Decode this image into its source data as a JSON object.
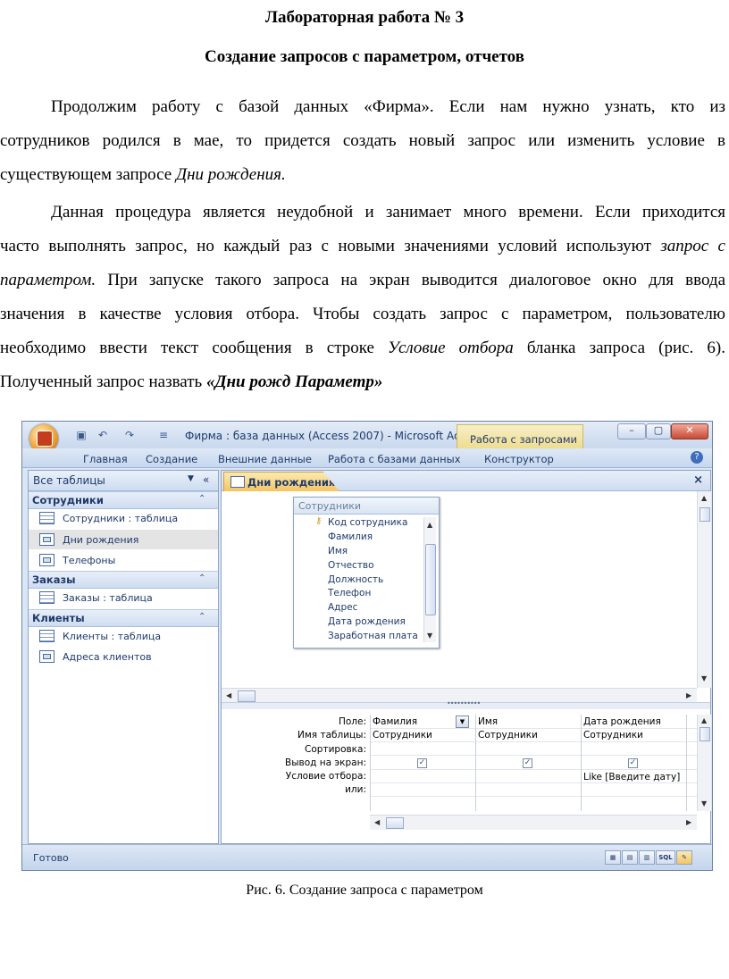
{
  "document": {
    "heading1": "Лабораторная работа № 3",
    "heading2": "Создание запросов с параметром,  отчетов",
    "p1": {
      "t1": "Продолжим работу с базой данных «Фирма». Если нам нужно узнать, кто из",
      "t2": "сотрудников родился в мае, то придется создать новый запрос или изменить условие в",
      "t3a": "существующем запросе ",
      "t3i": "Дни рождения."
    },
    "p2": {
      "l1": "Данная процедура является неудобной и занимает много времени. Если приходится",
      "l2a": "часто выполнять запрос, но каждый раз с новыми значениями условий используют ",
      "l2i": "запрос с",
      "l3i": "параметром.",
      "l3b": " При запуске такого запроса на экран  выводится диалоговое окно для ввода",
      "l4": "значения в качестве условия отбора. Чтобы создать запрос с параметром, пользователю",
      "l5a": "необходимо ввести текст сообщения в строке ",
      "l5i": "Условие отбора",
      "l5b": " бланка запроса (рис. 6).",
      "l6a": "Полученный запрос назвать ",
      "l6bi": "«Дни рожд Параметр»"
    },
    "caption": "Рис. 6. Создание запроса с параметром"
  },
  "window": {
    "title": "Фирма : база данных (Access 2007) - Microsoft Acce...",
    "context_tab": "Работа с запросами",
    "ribbon_tabs": [
      "Главная",
      "Создание",
      "Внешние данные",
      "Работа с базами данных",
      "Конструктор"
    ],
    "nav": {
      "header": "Все таблицы",
      "groups": [
        {
          "name": "Сотрудники",
          "items": [
            "Сотрудники : таблица",
            "Дни рождения",
            "Телефоны"
          ]
        },
        {
          "name": "Заказы",
          "items": [
            "Заказы : таблица"
          ]
        },
        {
          "name": "Клиенты",
          "items": [
            "Клиенты : таблица",
            "Адреса клиентов"
          ]
        }
      ]
    },
    "doc_tab": "Дни рождения",
    "field_list": {
      "title": "Сотрудники",
      "fields": [
        "Код сотрудника",
        "Фамилия",
        "Имя",
        "Отчество",
        "Должность",
        "Телефон",
        "Адрес",
        "Дата рождения",
        "Заработная плата"
      ]
    },
    "grid": {
      "row_labels": [
        "Поле:",
        "Имя таблицы:",
        "Сортировка:",
        "Вывод на экран:",
        "Условие отбора:",
        "или:"
      ],
      "columns": [
        {
          "field": "Фамилия",
          "table": "Сотрудники",
          "show": true,
          "criteria": ""
        },
        {
          "field": "Имя",
          "table": "Сотрудники",
          "show": true,
          "criteria": ""
        },
        {
          "field": "Дата рождения",
          "table": "Сотрудники",
          "show": true,
          "criteria": "Like [Введите дату]"
        }
      ]
    },
    "status": "Готово",
    "view_buttons": [
      "datasheet-view",
      "pivot-view",
      "pivotchart-view",
      "SQL",
      "design-view"
    ]
  }
}
